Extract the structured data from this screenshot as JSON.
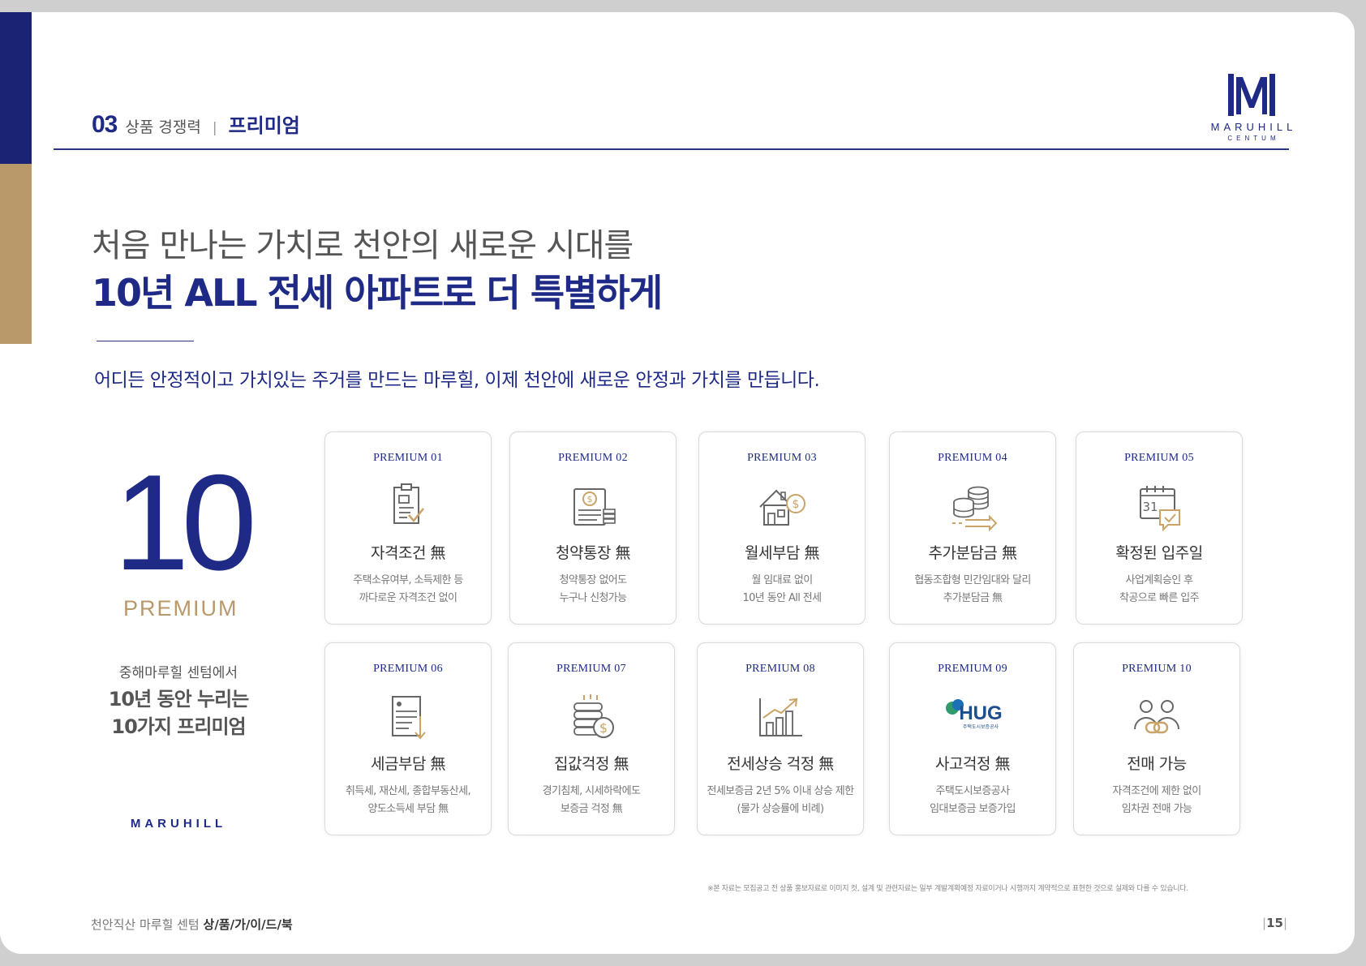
{
  "header": {
    "section_number": "03",
    "section_name": "상품 경쟁력",
    "separator": "|",
    "section_sub": "프리미엄",
    "logo": {
      "mark": "M",
      "name": "MARUHILL",
      "sub": "CENTUM"
    }
  },
  "headline": {
    "line1": "처음 만나는 가치로 천안의 새로운 시대를",
    "line2": "10년 ALL 전세 아파트로 더 특별하게"
  },
  "lead": "어디든 안정적이고 가치있는 주거를 만드는 마루힐, 이제 천안에 새로운 안정과 가치를 만듭니다.",
  "side": {
    "big_number": "10",
    "big_label": "PREMIUM",
    "intro": "중해마루힐 센텀에서",
    "bold_line1": "10년 동안 누리는",
    "bold_line2": "10가지 프리미엄",
    "brand": "MARUHILL"
  },
  "cards": [
    {
      "tag": "PREMIUM 01",
      "icon": "checklist-document-icon",
      "title": "자격조건 無",
      "desc1": "주택소유여부, 소득제한 등",
      "desc2": "까다로운 자격조건 없이"
    },
    {
      "tag": "PREMIUM 02",
      "icon": "bankbook-coin-icon",
      "title": "청약통장 無",
      "desc1": "청약통장 없어도",
      "desc2": "누구나 신청가능"
    },
    {
      "tag": "PREMIUM 03",
      "icon": "house-dollar-icon",
      "title": "월세부담 無",
      "desc1": "월 임대료 없이",
      "desc2": "10년 동안 All 전세"
    },
    {
      "tag": "PREMIUM 04",
      "icon": "coin-stack-arrow-icon",
      "title": "추가분담금 無",
      "desc1": "협동조합형 민간임대와 달리",
      "desc2": "추가분담금 無"
    },
    {
      "tag": "PREMIUM 05",
      "icon": "calendar-check-icon",
      "title": "확정된 입주일",
      "desc1": "사업계획승인 후",
      "desc2": "착공으로 빠른 입주"
    },
    {
      "tag": "PREMIUM 06",
      "icon": "tax-document-icon",
      "title": "세금부담 無",
      "desc1": "취득세, 재산세, 종합부동산세,",
      "desc2": "양도소득세 부담 無"
    },
    {
      "tag": "PREMIUM 07",
      "icon": "money-stack-coin-icon",
      "title": "집값걱정 無",
      "desc1": "경기침체, 시세하락에도",
      "desc2": "보증금 걱정 無"
    },
    {
      "tag": "PREMIUM 08",
      "icon": "rising-chart-icon",
      "title": "전세상승 걱정 無",
      "desc1": "전세보증금 2년 5% 이내 상승 제한",
      "desc2": "(물가 상승률에 비례)"
    },
    {
      "tag": "PREMIUM 09",
      "icon": "hug-logo-icon",
      "title": "사고걱정 無",
      "desc1": "주택도시보증공사",
      "desc2": "임대보증금 보증가입",
      "logo_text": "HUG",
      "logo_sub": "주택도시보증공사"
    },
    {
      "tag": "PREMIUM 10",
      "icon": "people-link-icon",
      "title": "전매 가능",
      "desc1": "자격조건에 제한 없이",
      "desc2": "임차권 전매 가능"
    }
  ],
  "disclaimer": "※본 자료는 모집공고 전 상품 홍보자료로 이미지 컷, 설계 및 관련자료는 일부 계발계획예정 자료이거나 시행까지 계약적으로 표현한 것으로 실제와 다를 수 있습니다.",
  "footer": {
    "prefix": "천안직산 마루힐 센텀",
    "guide": "상/품/가/이/드/북",
    "page": "15",
    "page_bar": "|"
  },
  "colors": {
    "navy": "#1e2a85",
    "gold": "#b9986a",
    "gray_text": "#555555"
  }
}
